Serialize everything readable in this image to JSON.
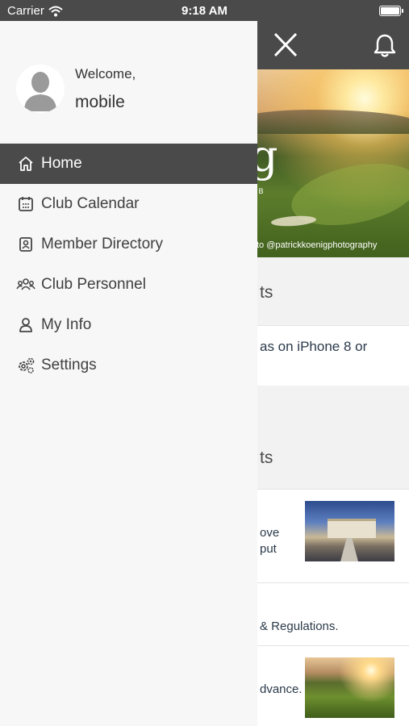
{
  "status_bar": {
    "carrier": "Carrier",
    "time": "9:18 AM"
  },
  "drawer": {
    "welcome": "Welcome,",
    "username": "mobile",
    "menu": [
      {
        "label": "Home",
        "icon": "home-icon",
        "active": true
      },
      {
        "label": "Club Calendar",
        "icon": "calendar-icon",
        "active": false
      },
      {
        "label": "Member Directory",
        "icon": "contact-book-icon",
        "active": false
      },
      {
        "label": "Club Personnel",
        "icon": "people-group-icon",
        "active": false
      },
      {
        "label": "My Info",
        "icon": "person-icon",
        "active": false
      },
      {
        "label": "Settings",
        "icon": "gears-icon",
        "active": false
      }
    ]
  },
  "background_page": {
    "hero_logo_letter": "g",
    "hero_logo_sub": "UB",
    "hero_credit": "to @patrickkoenigphotography",
    "section1_title": "ts",
    "row1_text": "as on iPhone 8 or",
    "section2_title": "ts",
    "row2_line1": "ove",
    "row2_line2": "put",
    "row3_text": "& Regulations.",
    "row4_text": "dvance."
  },
  "colors": {
    "header": "#4a4a4a",
    "drawer_bg": "#f7f7f7",
    "active_item": "#4a4a4a"
  }
}
